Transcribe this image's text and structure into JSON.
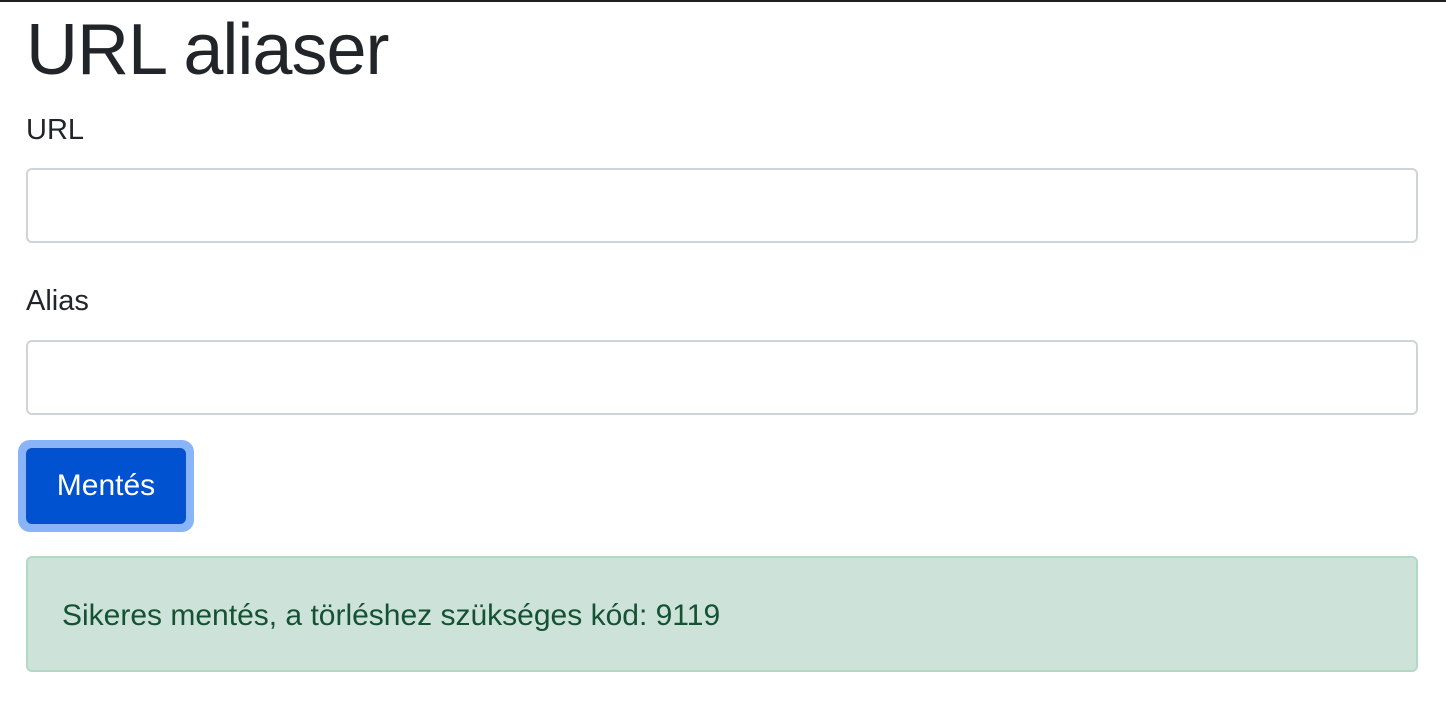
{
  "page": {
    "title": "URL aliaser"
  },
  "form": {
    "url_label": "URL",
    "url_value": "",
    "alias_label": "Alias",
    "alias_value": "",
    "submit_label": "Mentés"
  },
  "alert": {
    "message": "Sikeres mentés, a törléshez szükséges kód: 9119",
    "type": "success"
  },
  "colors": {
    "primary": "#0052d0",
    "focus_ring": "#8ab4f8",
    "success_bg": "#cde3da",
    "success_text": "#155233"
  }
}
